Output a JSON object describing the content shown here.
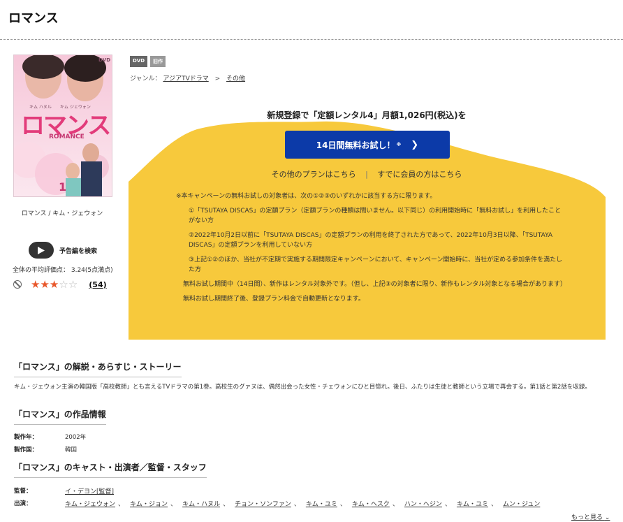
{
  "page": {
    "title": "ロマンス"
  },
  "cover": {
    "title": "ロマンス",
    "subtitle": "ROMANCE",
    "volume": "1",
    "format_logo": "DVD",
    "names": "キム ハヌル　　キム ジェウォン"
  },
  "item": {
    "caption": "ロマンス / キム・ジェウォン",
    "badges": [
      "DVD",
      "旧作"
    ],
    "genre_label": "ジャンル：",
    "genre_1": "アジアTVドラマ",
    "genre_sep": ">",
    "genre_2": "その他"
  },
  "trailer": {
    "label": "予告編を検索"
  },
  "rating": {
    "label": "全体の平均評価点： 3.24(5点満点)",
    "stars_filled": 3.24,
    "stars_max": 5,
    "review_count": "(54)"
  },
  "campaign": {
    "headline": "新規登録で「定額レンタル4」月額1,026円(税込)を",
    "trial_button": "14日間無料お試し！",
    "trial_note": "※",
    "other_plans": "その他のプランはこちら",
    "divider": "|",
    "members": "すでに会員の方はこちら",
    "bg_color": "#f7c93c",
    "button_color": "#0c3aa8",
    "notes": [
      "※本キャンペーンの無料お試しの対象者は、次の①②③のいずれかに該当する方に限ります。",
      "①「TSUTAYA DISCAS」の定額プラン（定額プランの種類は問いません。以下同じ）の利用開始時に「無料お試し」を利用したことがない方",
      "②2022年10月2日以前に「TSUTAYA DISCAS」の定額プランの利用を終了された方であって、2022年10月3日以降、「TSUTAYA DISCAS」の定額プランを利用していない方",
      "③上記①②のほか、当社が不定期で実施する期間限定キャンペーンにおいて、キャンペーン開始時に、当社が定める参加条件を満たした方",
      "無料お試し期間中（14日間）、新作はレンタル対象外です。（但し、上記③の対象者に限り、新作もレンタル対象となる場合があります）",
      "無料お試し期間終了後、登録プラン料金で自動更新となります。"
    ]
  },
  "synopsis": {
    "heading": "「ロマンス」の解説・あらすじ・ストーリー",
    "text": "キム・ジェウォン主演の韓国版「高校教師」とも言えるTVドラマの第1巻。高校生のグァヌは、偶然出会った女性・チェウォンにひと目惚れ。後日、ふたりは生徒と教師という立場で再会する。第1話と第2話を収録。"
  },
  "info": {
    "heading": "「ロマンス」の作品情報",
    "year_label": "製作年：",
    "year": "2002年",
    "country_label": "製作国：",
    "country": "韓国"
  },
  "cast": {
    "heading": "「ロマンス」のキャスト・出演者／監督・スタッフ",
    "director_label": "監督：",
    "director": "イ・デヨン[監督]",
    "cast_label": "出演：",
    "members": [
      "キム・ジェウォン",
      "キム・ジョン",
      "キム・ハヌル",
      "チョン・ソンファン",
      "キム・ユミ",
      "キム・ヘスク",
      "ハン・ヘジン",
      "キム・ユミ",
      "ムン・ジュン"
    ],
    "comma": "、",
    "more": "もっと見る"
  }
}
